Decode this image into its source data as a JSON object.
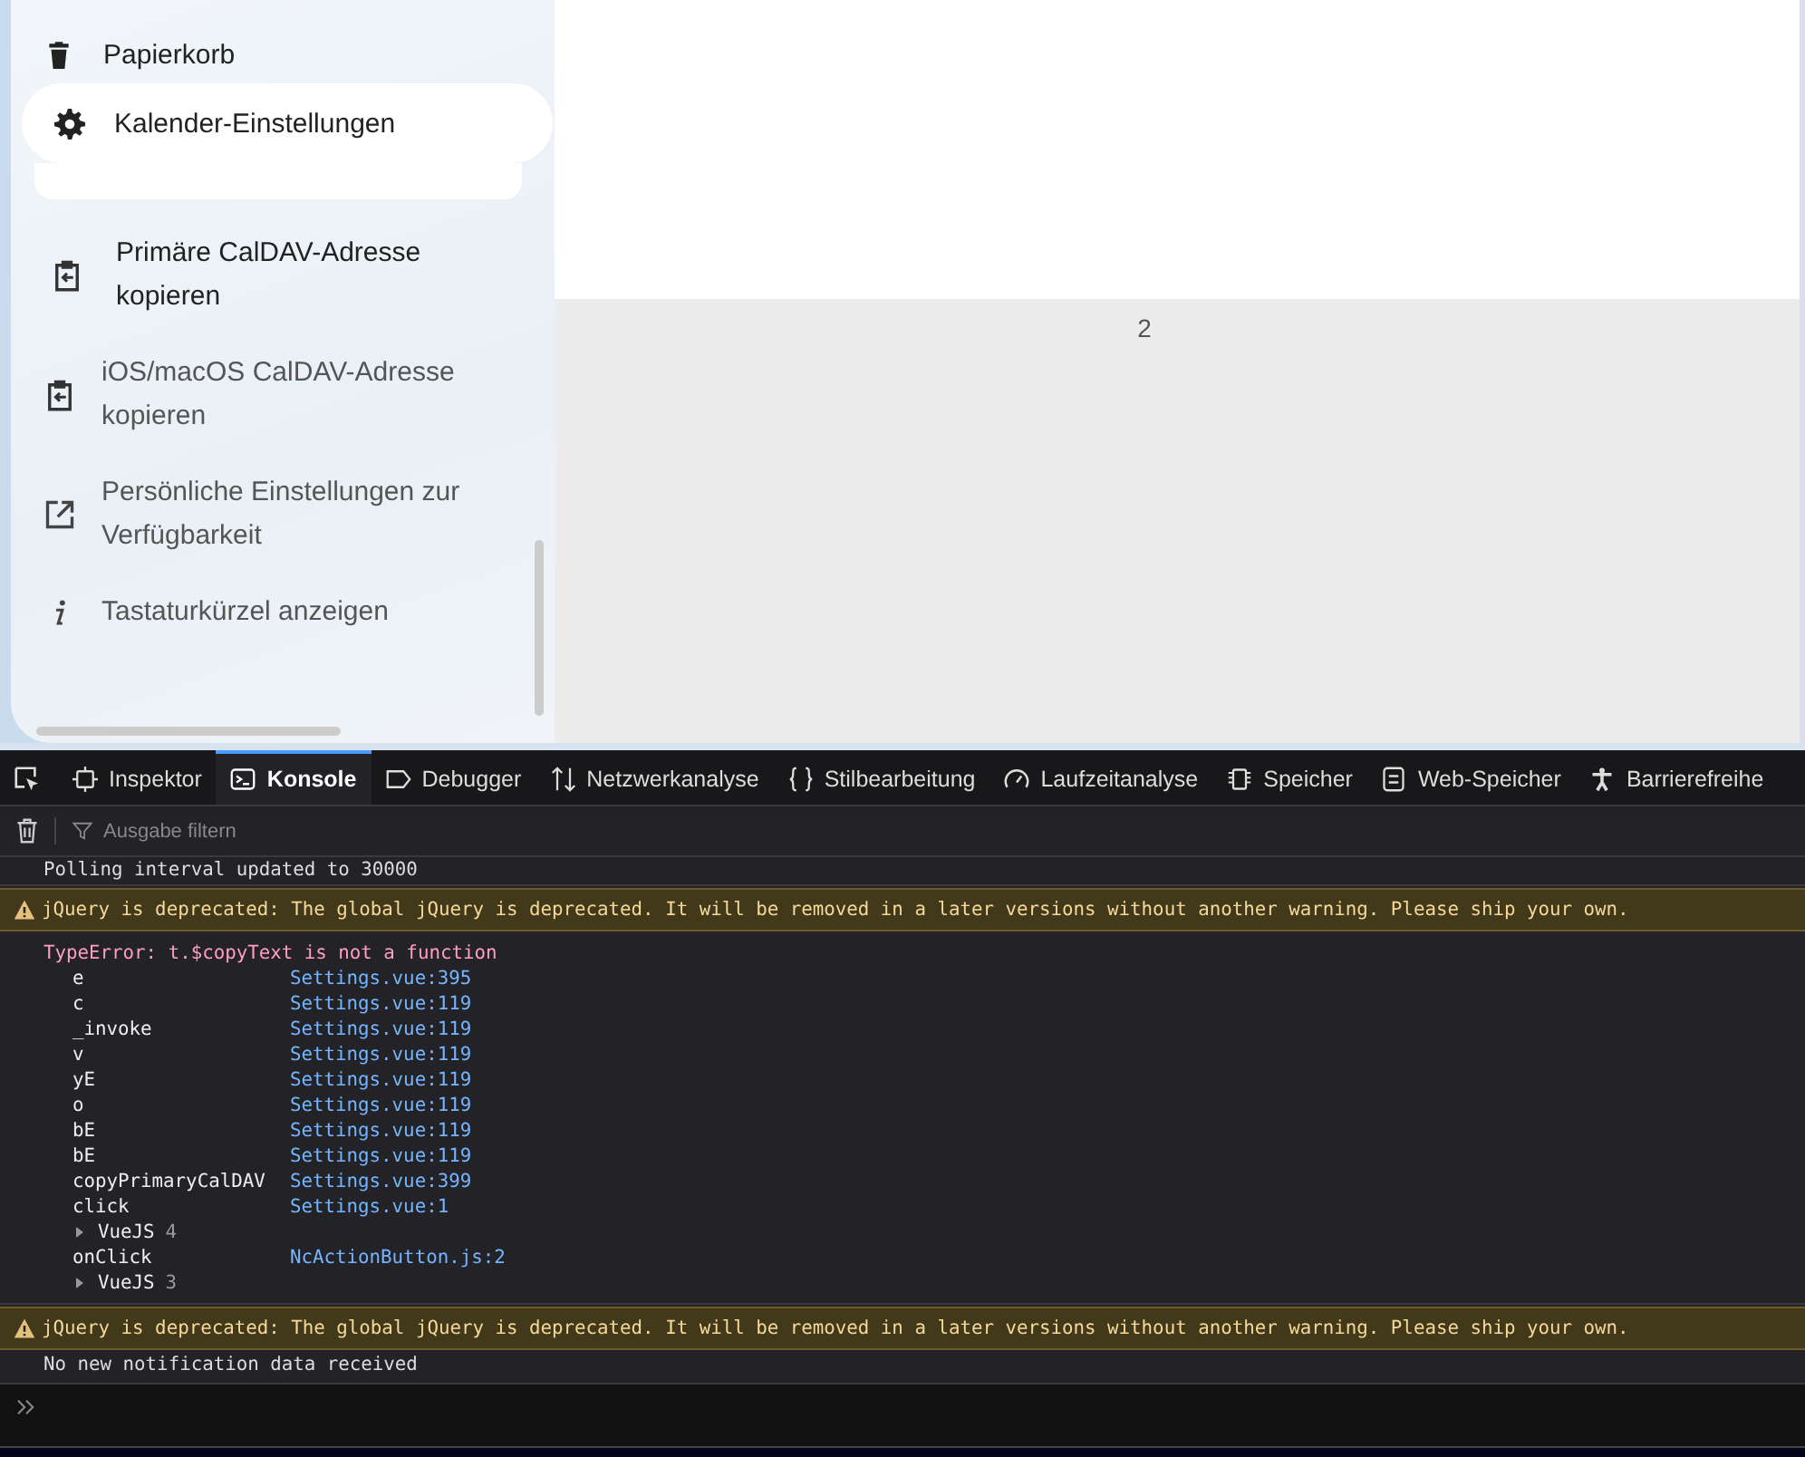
{
  "sidebar": {
    "items": [
      {
        "label": "Papierkorb",
        "selected": false
      },
      {
        "label": "Kalender-Einstellungen",
        "selected": true
      }
    ],
    "actions": [
      {
        "label": "Primäre CalDAV-Adresse kopieren",
        "hovered": true
      },
      {
        "label": "iOS/macOS CalDAV-Adresse kopieren",
        "hovered": false
      },
      {
        "label": "Persönliche Einstellungen zur Verfügbarkeit",
        "hovered": false
      },
      {
        "label": "Tastaturkürzel anzeigen",
        "hovered": false
      }
    ]
  },
  "main": {
    "page_number": "2"
  },
  "devtools": {
    "tabs": [
      {
        "label": "Inspektor",
        "selected": false
      },
      {
        "label": "Konsole",
        "selected": true
      },
      {
        "label": "Debugger",
        "selected": false
      },
      {
        "label": "Netzwerkanalyse",
        "selected": false
      },
      {
        "label": "Stilbearbeitung",
        "selected": false
      },
      {
        "label": "Laufzeitanalyse",
        "selected": false
      },
      {
        "label": "Speicher",
        "selected": false
      },
      {
        "label": "Web-Speicher",
        "selected": false
      },
      {
        "label": "Barrierefreihe",
        "selected": false
      }
    ],
    "filter": {
      "placeholder": "Ausgabe filtern"
    },
    "messages": [
      {
        "kind": "log",
        "text": "Polling interval updated to 30000"
      },
      {
        "kind": "warning",
        "text": "jQuery is deprecated: The global jQuery is deprecated. It will be removed in a later versions without another warning. Please ship your own."
      },
      {
        "kind": "error",
        "text": "TypeError: t.$copyText is not a function",
        "stack": [
          {
            "kind": "frame",
            "name": "e",
            "location": "Settings.vue:395"
          },
          {
            "kind": "frame",
            "name": "c",
            "location": "Settings.vue:119"
          },
          {
            "kind": "frame",
            "name": "_invoke",
            "location": "Settings.vue:119"
          },
          {
            "kind": "frame",
            "name": "v",
            "location": "Settings.vue:119"
          },
          {
            "kind": "frame",
            "name": "yE",
            "location": "Settings.vue:119"
          },
          {
            "kind": "frame",
            "name": "o",
            "location": "Settings.vue:119"
          },
          {
            "kind": "frame",
            "name": "bE",
            "location": "Settings.vue:119"
          },
          {
            "kind": "frame",
            "name": "bE",
            "location": "Settings.vue:119"
          },
          {
            "kind": "frame",
            "name": "copyPrimaryCalDAV",
            "location": "Settings.vue:399"
          },
          {
            "kind": "frame",
            "name": "click",
            "location": "Settings.vue:1"
          },
          {
            "kind": "group",
            "name": "VueJS",
            "count": "4"
          },
          {
            "kind": "frame",
            "name": "onClick",
            "location": "NcActionButton.js:2"
          },
          {
            "kind": "group",
            "name": "VueJS",
            "count": "3"
          }
        ]
      },
      {
        "kind": "warning",
        "text": "jQuery is deprecated: The global jQuery is deprecated. It will be removed in a later versions without another warning. Please ship your own."
      },
      {
        "kind": "log",
        "text": "No new notification data received"
      }
    ]
  }
}
